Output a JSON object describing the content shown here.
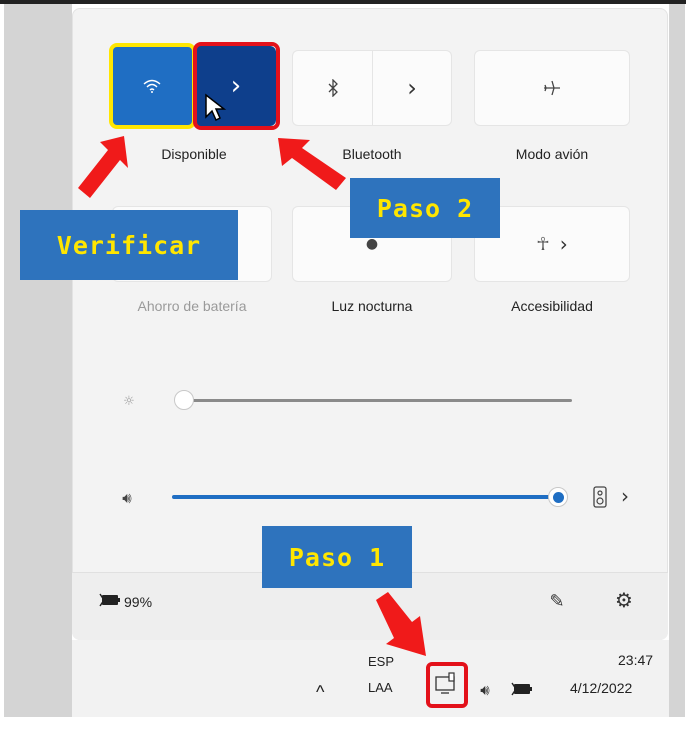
{
  "quick_settings": {
    "tiles": [
      {
        "label": "Disponible",
        "icon": "wifi-icon",
        "state": "on"
      },
      {
        "label": "Bluetooth",
        "icon": "bluetooth-icon",
        "state": "off"
      },
      {
        "label": "Modo avión",
        "icon": "airplane-icon",
        "state": "off"
      },
      {
        "label": "Ahorro de batería",
        "icon": "battery-saver-icon",
        "state": "disabled"
      },
      {
        "label": "Luz nocturna",
        "icon": "night-light-icon",
        "state": "off"
      },
      {
        "label": "Accesibilidad",
        "icon": "accessibility-icon",
        "state": "off"
      }
    ],
    "arrow_glyph": "›",
    "brightness_level": 0.0,
    "volume_level": 1.0,
    "battery_text": "99%"
  },
  "taskbar": {
    "lang_top": "ESP",
    "lang_bottom": "LAA",
    "time": "23:47",
    "date": "4/12/2022",
    "chevron": "^"
  },
  "annotations": {
    "verificar": "Verificar",
    "paso1": "Paso 1",
    "paso2": "Paso 2"
  },
  "colors": {
    "accent": "#1f6ec3",
    "accent_dark": "#0e3f8c",
    "callout_bg": "#2e73bd",
    "callout_text": "#ffe600",
    "highlight_red": "#e3111a",
    "highlight_yellow": "#ffe600"
  }
}
